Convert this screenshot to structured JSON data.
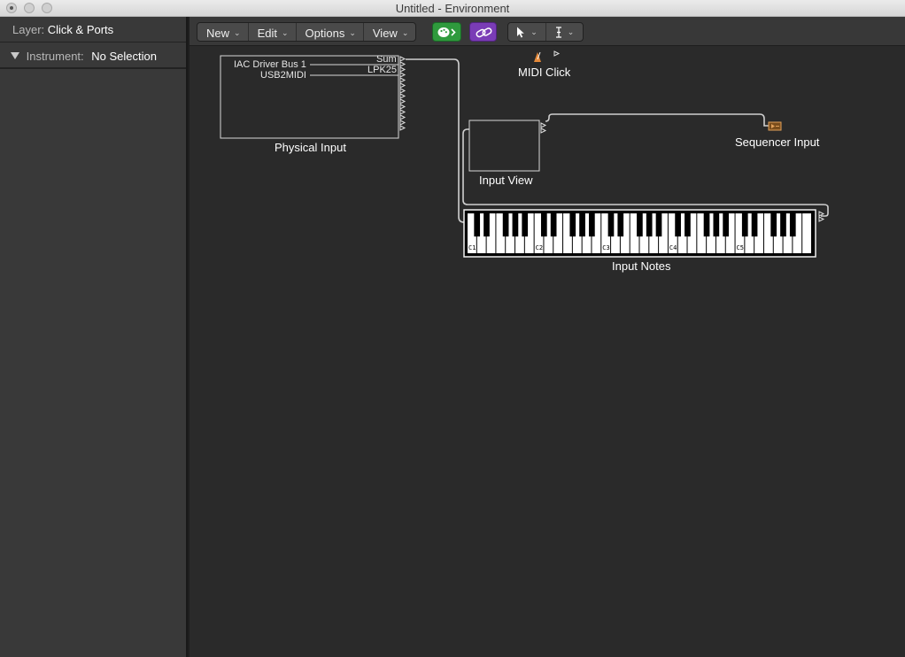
{
  "window": {
    "title": "Untitled - Environment"
  },
  "inspector": {
    "layer_label": "Layer:",
    "layer_value": "Click & Ports",
    "instrument_label": "Instrument:",
    "instrument_value": "No Selection"
  },
  "toolbar": {
    "menus": [
      "New",
      "Edit",
      "Options",
      "View"
    ],
    "tools": [
      "pointer-tool",
      "text-cursor-tool"
    ]
  },
  "canvas": {
    "physical_input": {
      "label": "Physical Input",
      "ports": [
        "IAC Driver Bus 1",
        "USB2MIDI"
      ],
      "outputs": [
        "Sum",
        "LPK25"
      ]
    },
    "midi_click": {
      "label": "MIDI Click"
    },
    "input_view": {
      "label": "Input View"
    },
    "sequencer_input": {
      "label": "Sequencer Input"
    },
    "input_notes": {
      "label": "Input Notes",
      "octave_labels": [
        "C1",
        "C2",
        "C3",
        "C4",
        "C5"
      ]
    }
  },
  "colors": {
    "green_button": "#2f9a3d",
    "purple_button": "#7a3cb6",
    "canvas_bg": "#2a2a2a"
  }
}
